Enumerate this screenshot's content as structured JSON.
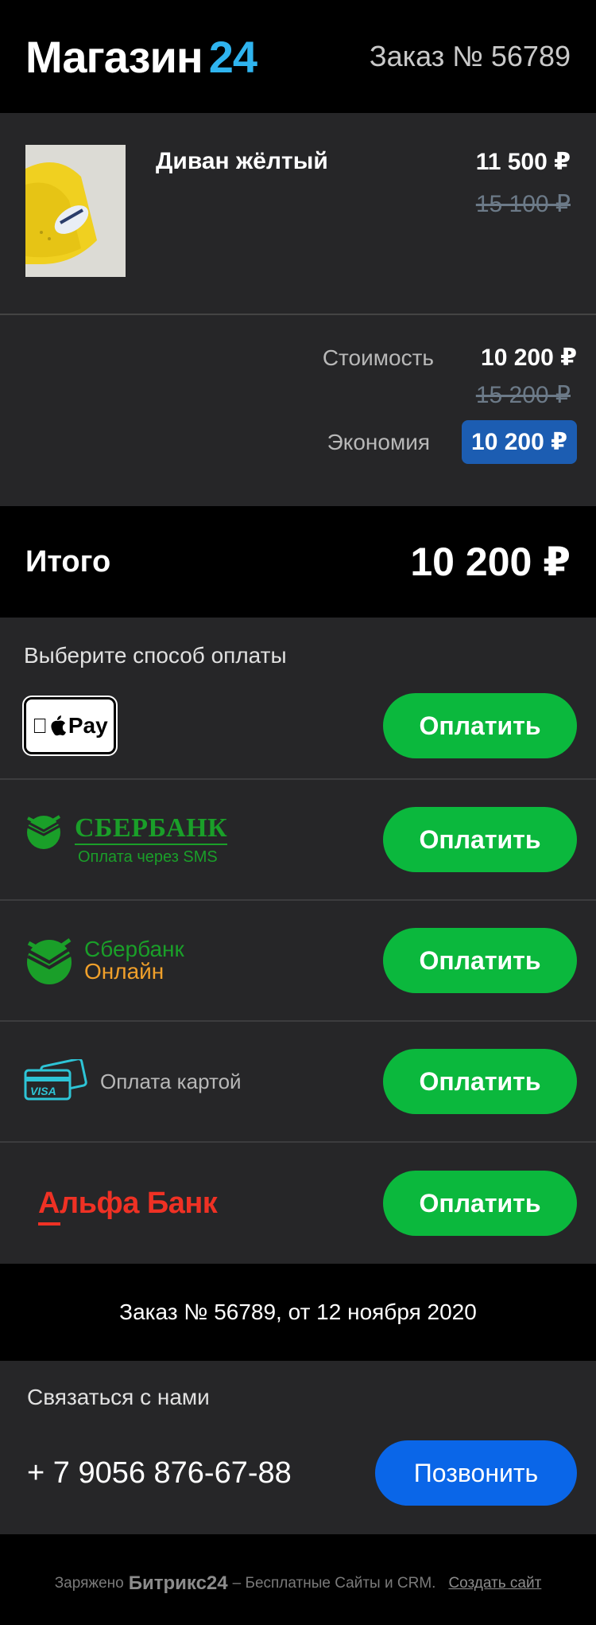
{
  "header": {
    "logo_text": "Магазин",
    "logo_num": "24",
    "order_title": "Заказ № 56789"
  },
  "product": {
    "name": "Диван жёлтый",
    "price_now": "11 500 ₽",
    "price_old": "15 100 ₽"
  },
  "summary": {
    "cost_label": "Стоимость",
    "cost_value": "10 200 ₽",
    "cost_old": "15 200 ₽",
    "save_label": "Экономия",
    "save_value": "10 200 ₽"
  },
  "total": {
    "label": "Итого",
    "value": "10 200 ₽"
  },
  "payments": {
    "title": "Выберите способ оплаты",
    "button_label": "Оплатить",
    "apple_pay": "Pay",
    "sber_sms_title": "СБЕРБАНК",
    "sber_sms_sub": "Оплата через SMS",
    "sber_online_1": "Сбербанк",
    "sber_online_2": "Онлайн",
    "card_text": "Оплата картой",
    "card_brand": "VISA",
    "alfa": "Альфа Банк"
  },
  "order_line": "Заказ № 56789, от 12 ноября 2020",
  "contact": {
    "title": "Связаться с нами",
    "phone": "+ 7 9056 876-67-88",
    "call_label": "Позвонить"
  },
  "footer": {
    "charged": "Заряжено",
    "brand": "Битрикс24",
    "tagline": "– Бесплатные Сайты и CRM.",
    "create": "Создать сайт"
  },
  "colors": {
    "accent_blue": "#2fb4ef",
    "pay_green": "#0bb83d",
    "call_blue": "#0a66e8",
    "save_badge": "#1c5db2",
    "alfa_red": "#ef3124",
    "sber_green": "#1a9f29"
  }
}
